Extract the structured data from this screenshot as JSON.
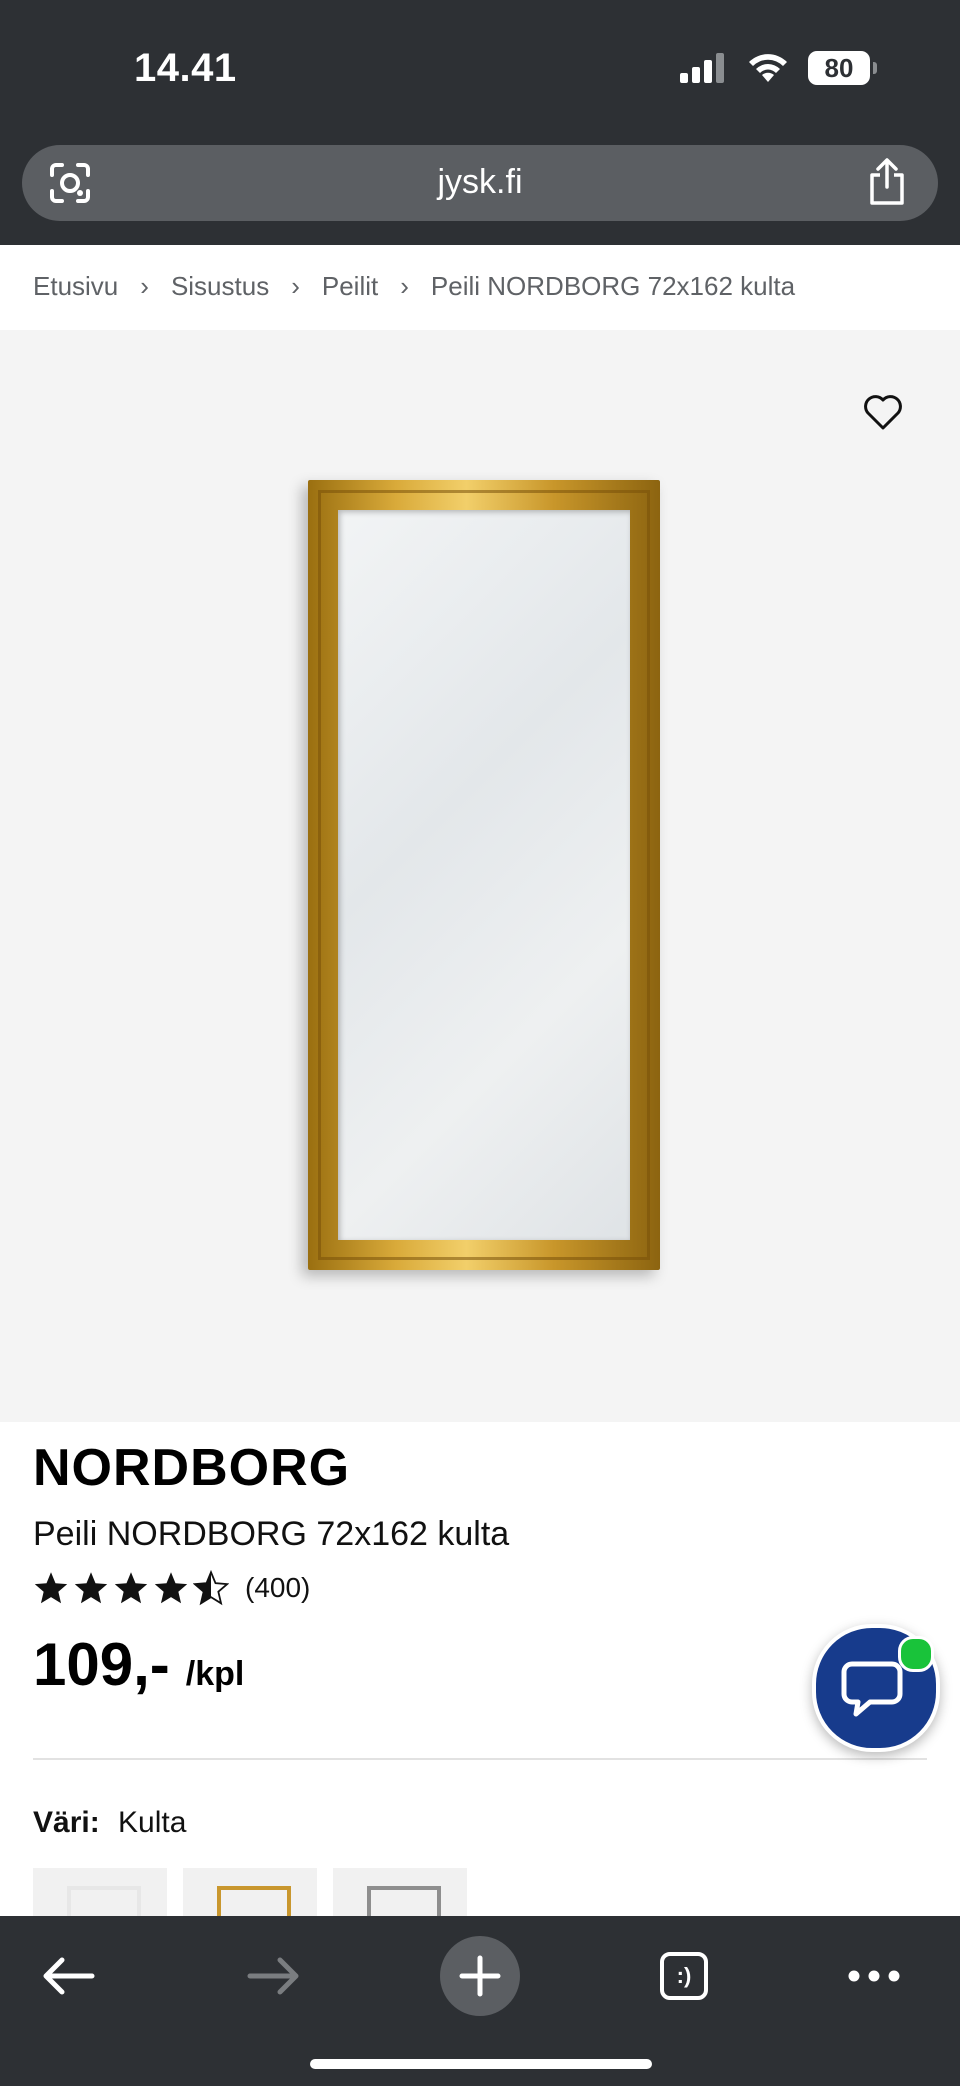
{
  "status_bar": {
    "time": "14.41",
    "battery": "80",
    "icons": [
      "signal-icon",
      "wifi-icon",
      "battery-icon"
    ]
  },
  "browser": {
    "url": "jysk.fi",
    "left_icon": "visual-search-icon",
    "right_icon": "share-icon"
  },
  "breadcrumb": {
    "items": [
      "Etusivu",
      "Sisustus",
      "Peilit",
      "Peili NORDBORG 72x162 kulta"
    ],
    "separator": "›"
  },
  "product": {
    "brand": "NORDBORG",
    "name": "Peili NORDBORG 72x162 kulta",
    "rating_value": 4.5,
    "rating_max": 5,
    "rating_count": "(400)",
    "price": "109,-",
    "price_unit": "/kpl",
    "color_label": "Väri:",
    "color_value": "Kulta",
    "swatch_colors": [
      "#e7e7e7",
      "#c9972e",
      "#8e8e8e"
    ]
  },
  "colors": {
    "chrome_bg": "#2d3034",
    "url_bar_bg": "#5b5e62",
    "chat_button": "#173b8c",
    "online_dot": "#19c33a",
    "image_bg": "#f4f4f4"
  },
  "toolbar": {
    "buttons": [
      "back-arrow-icon",
      "forward-arrow-icon",
      "new-tab-plus-icon",
      "tabs-icon",
      "more-icon"
    ],
    "tabs_label": ":)"
  }
}
